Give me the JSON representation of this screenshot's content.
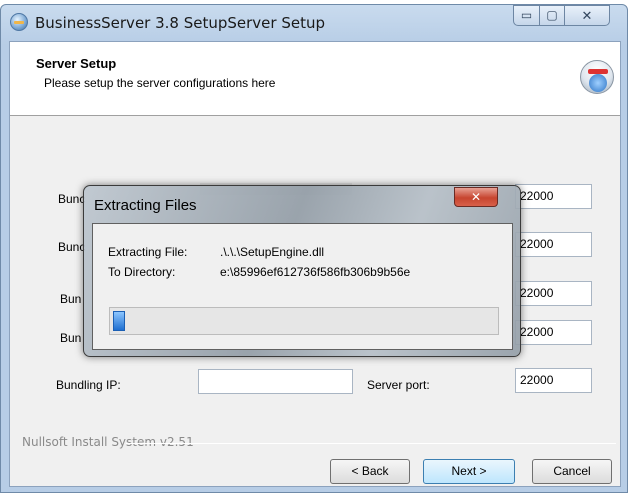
{
  "window": {
    "title": "BusinessServer 3.8 SetupServer Setup",
    "minimize_glyph": "▭",
    "maximize_glyph": "▢",
    "close_glyph": "✕"
  },
  "header": {
    "title": "Server Setup",
    "subtitle": "Please setup the server configurations here",
    "icon": "installer-disc-icon"
  },
  "form": {
    "rows": [
      {
        "label": "Bunc",
        "port_value": "22000"
      },
      {
        "label": "Bunc",
        "port_value": "22000"
      },
      {
        "label": "Bun",
        "port_value": "22000"
      },
      {
        "label": "Bun",
        "port_value": "22000"
      }
    ],
    "ip_label": "Bundling IP:",
    "ip_value": "",
    "port_label": "Server port:",
    "port_value": "22000"
  },
  "footer": {
    "branding": "Nullsoft Install System v2.51",
    "back_label": "< Back",
    "next_label": "Next >",
    "cancel_label": "Cancel"
  },
  "dialog": {
    "title": "Extracting Files",
    "close_glyph": "✕",
    "file_label": "Extracting File:",
    "file_value": ".\\.\\.\\SetupEngine.dll",
    "dir_label": "To Directory:",
    "dir_value": "e:\\85996ef612736f586fb306b9b56e",
    "progress_fraction": 0.03
  },
  "colors": {
    "accent": "#1f6fd0",
    "close_red": "#c7452f",
    "window_frame": "#b7cde6"
  }
}
